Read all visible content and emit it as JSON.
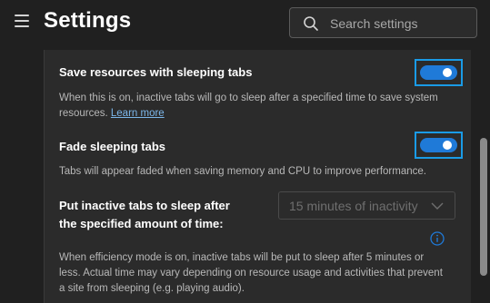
{
  "header": {
    "title": "Settings",
    "search_placeholder": "Search settings",
    "search_value": ""
  },
  "settings": {
    "sleeping_tabs": {
      "title": "Save resources with sleeping tabs",
      "desc_line1": "When this is on, inactive tabs will go to sleep after a specified time to save system",
      "desc_line2": "resources.",
      "learn_more": "Learn more",
      "enabled": true
    },
    "fade_tabs": {
      "title": "Fade sleeping tabs",
      "desc": "Tabs will appear faded when saving memory and CPU to improve performance.",
      "enabled": true
    },
    "inactive_timer": {
      "title_line1": "Put inactive tabs to sleep after",
      "title_line2": "the specified amount of time:",
      "selected": "15 minutes of inactivity"
    },
    "efficiency_note": {
      "line1": "When efficiency mode is on, inactive tabs will be put to sleep after 5 minutes or",
      "line2": "less. Actual time may vary depending on resource usage and activities that prevent",
      "line3": "a site from sleeping (e.g. playing audio)."
    }
  },
  "colors": {
    "background": "#202020",
    "panel": "#2b2b2b",
    "toggle_on": "#1f7ad8",
    "highlight_frame": "#1a9be6",
    "link": "#7cb7ea"
  },
  "icons": [
    "hamburger-menu-icon",
    "search-icon",
    "chevron-down-icon",
    "info-icon"
  ]
}
